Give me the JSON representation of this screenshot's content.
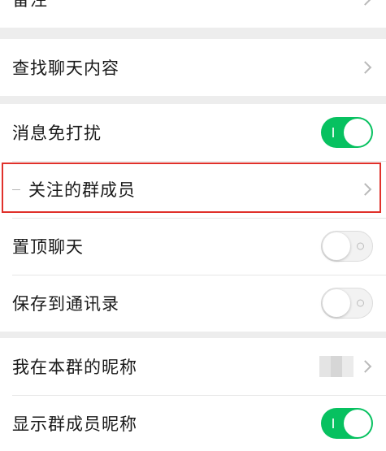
{
  "sections": [
    {
      "rows": [
        {
          "label": "备注",
          "control": "chevron"
        }
      ]
    },
    {
      "rows": [
        {
          "label": "查找聊天内容",
          "control": "chevron"
        }
      ]
    },
    {
      "rows": [
        {
          "label": "消息免打扰",
          "control": "toggle",
          "state": "on"
        },
        {
          "label": "关注的群成员",
          "control": "chevron",
          "highlighted": true
        },
        {
          "label": "置顶聊天",
          "control": "toggle",
          "state": "off"
        },
        {
          "label": "保存到通讯录",
          "control": "toggle",
          "state": "off"
        }
      ]
    },
    {
      "rows": [
        {
          "label": "我在本群的昵称",
          "control": "chevron",
          "value_blurred": true
        },
        {
          "label": "显示群成员昵称",
          "control": "toggle",
          "state": "on"
        }
      ]
    }
  ],
  "colors": {
    "toggle_on": "#07c160",
    "highlight_border": "#e0312b",
    "background": "#ededed"
  }
}
